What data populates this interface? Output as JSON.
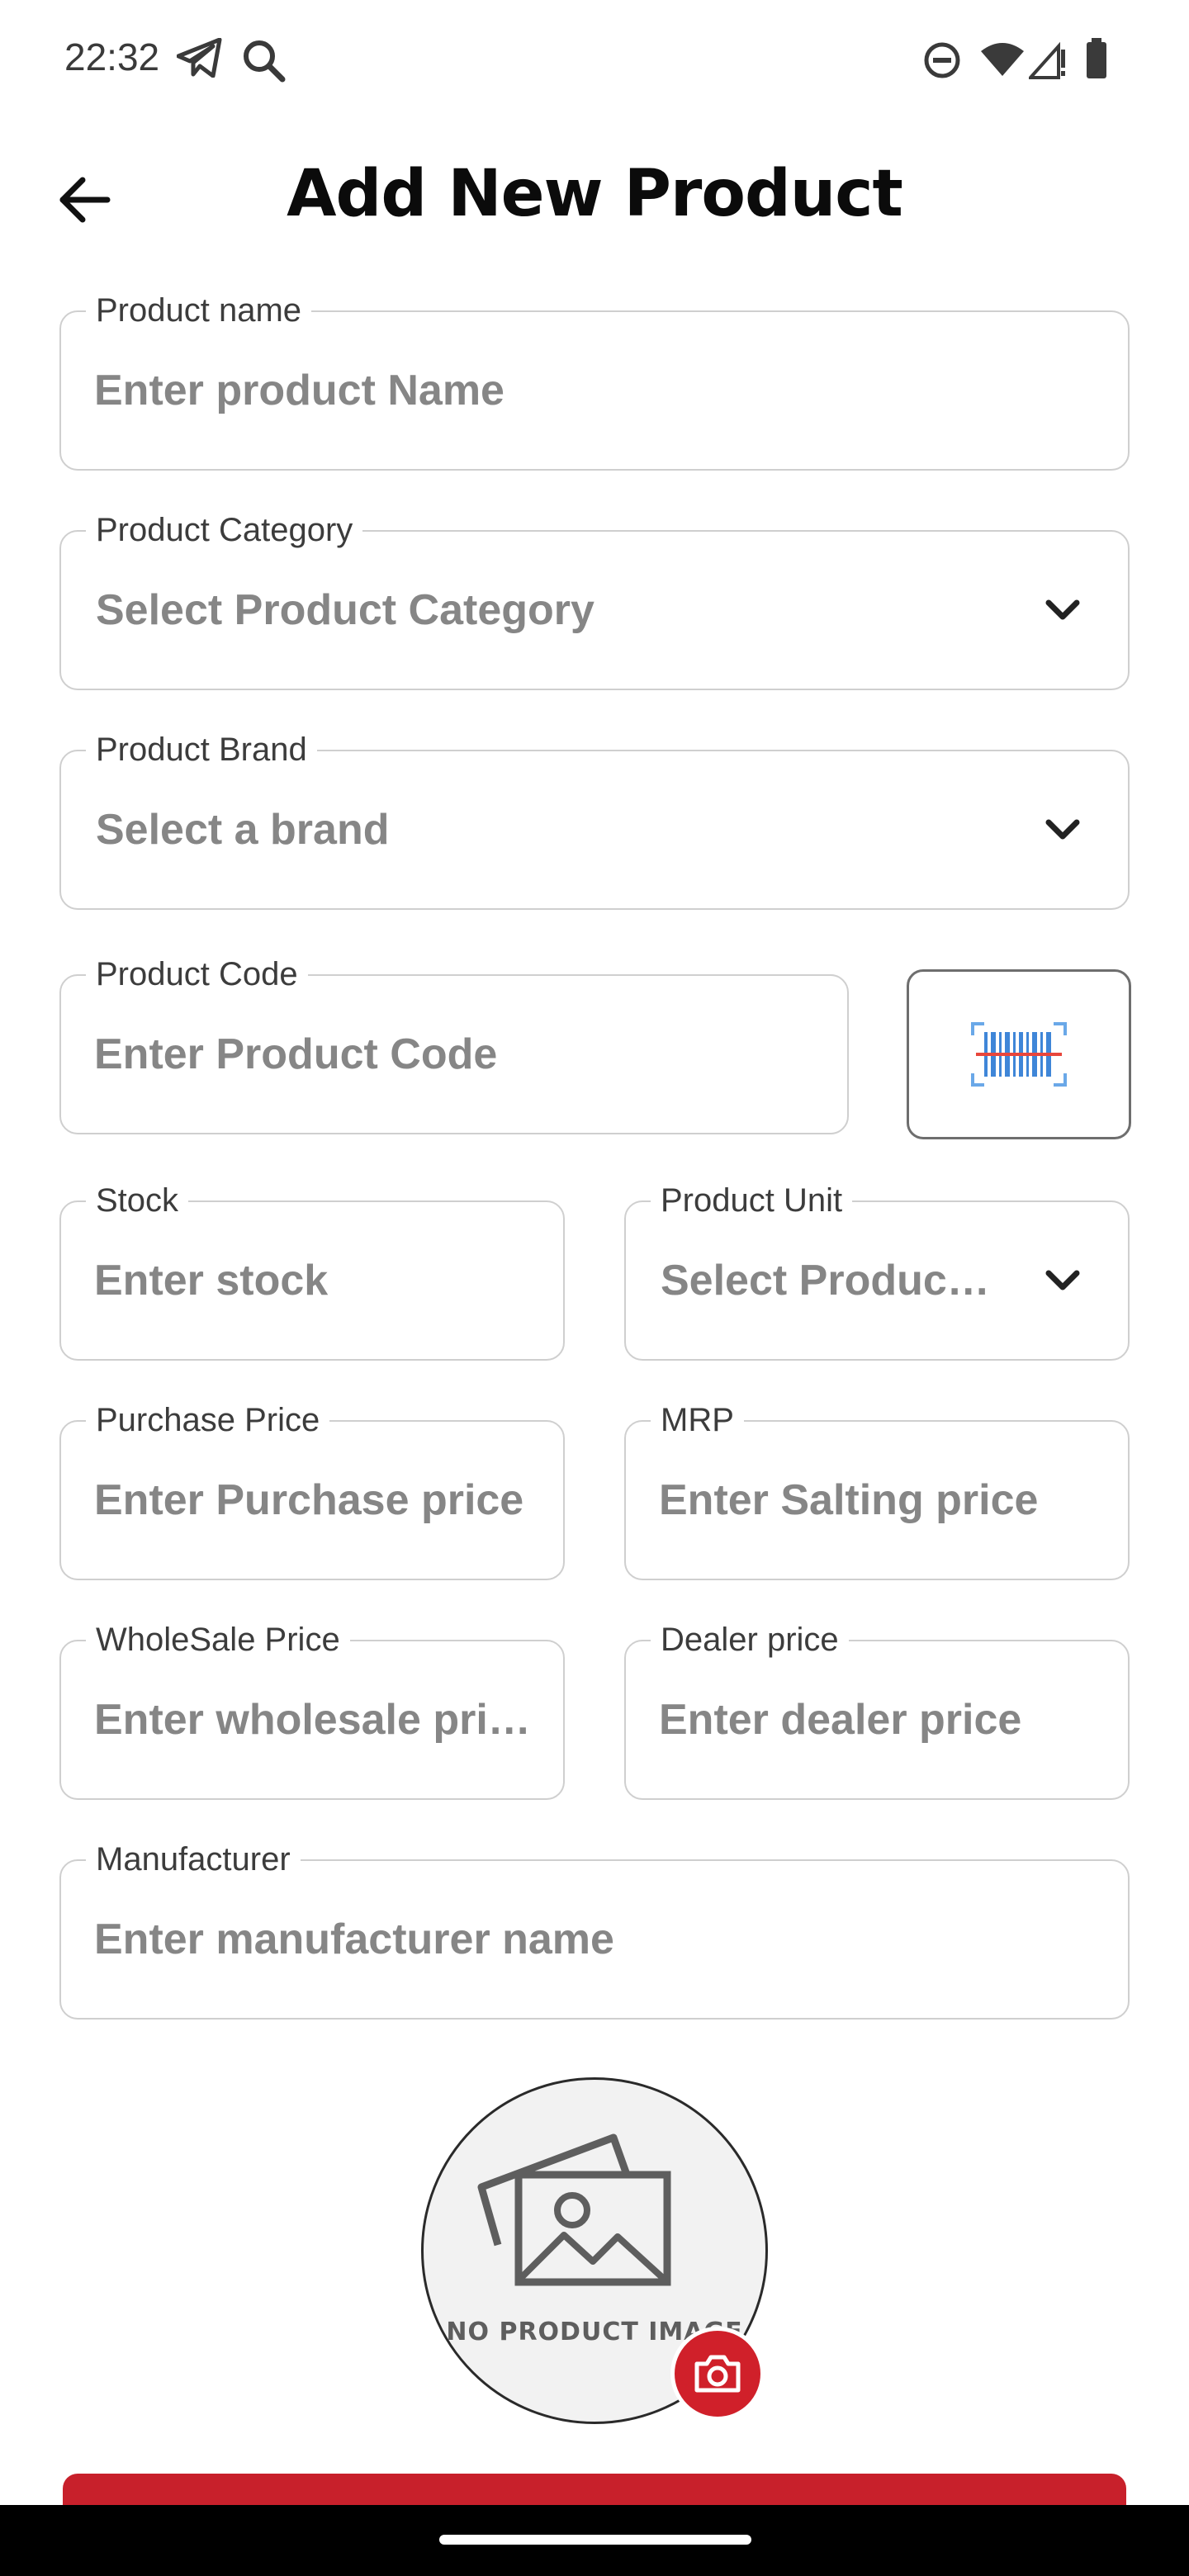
{
  "status_bar": {
    "time": "22:32",
    "icons": [
      "telegram-icon",
      "search-icon",
      "do-not-disturb-icon",
      "wifi-icon",
      "signal-icon",
      "battery-icon"
    ]
  },
  "header": {
    "title": "Add New Product",
    "back_icon": "arrow-left-icon"
  },
  "form": {
    "product_name": {
      "label": "Product name",
      "placeholder": "Enter product Name"
    },
    "product_category": {
      "label": "Product Category",
      "value": "Select Product Category"
    },
    "product_brand": {
      "label": "Product Brand",
      "value": "Select a brand"
    },
    "product_code": {
      "label": "Product Code",
      "placeholder": "Enter Product Code"
    },
    "stock": {
      "label": "Stock",
      "placeholder": "Enter stock"
    },
    "product_unit": {
      "label": "Product Unit",
      "value": "Select Produc…"
    },
    "purchase_price": {
      "label": "Purchase Price",
      "placeholder": "Enter Purchase price"
    },
    "mrp": {
      "label": "MRP",
      "placeholder": "Enter Salting price"
    },
    "wholesale_price": {
      "label": "WholeSale Price",
      "placeholder": "Enter wholesale pri…"
    },
    "dealer_price": {
      "label": "Dealer price",
      "placeholder": "Enter dealer price"
    },
    "manufacturer": {
      "label": "Manufacturer",
      "placeholder": "Enter manufacturer name"
    }
  },
  "image": {
    "placeholder_text": "NO PRODUCT IMAGE",
    "camera_icon": "camera-icon"
  },
  "colors": {
    "accent": "#c8202b",
    "border": "#cfcfcf",
    "placeholder": "#868686"
  }
}
